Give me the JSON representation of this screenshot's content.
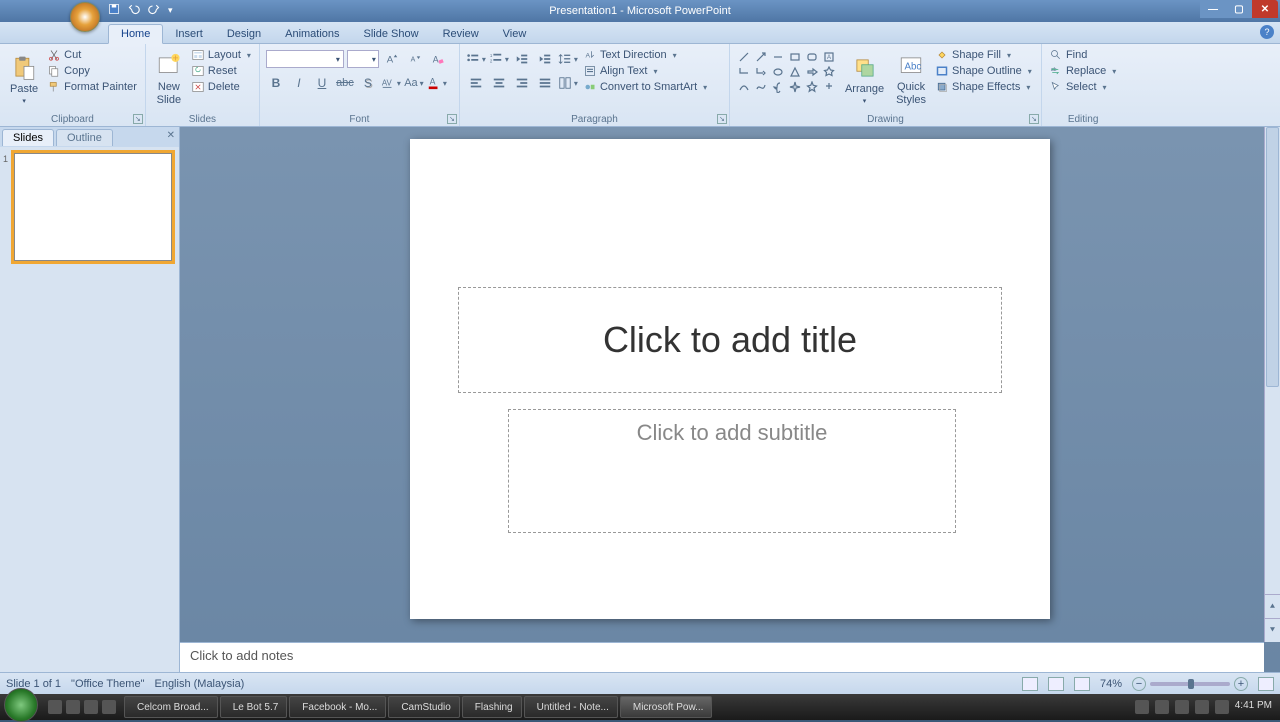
{
  "window": {
    "title": "Presentation1 - Microsoft PowerPoint"
  },
  "tabs": [
    "Home",
    "Insert",
    "Design",
    "Animations",
    "Slide Show",
    "Review",
    "View"
  ],
  "active_tab": "Home",
  "ribbon": {
    "clipboard": {
      "label": "Clipboard",
      "paste": "Paste",
      "cut": "Cut",
      "copy": "Copy",
      "format_painter": "Format Painter"
    },
    "slides": {
      "label": "Slides",
      "new_slide": "New\nSlide",
      "layout": "Layout",
      "reset": "Reset",
      "delete": "Delete"
    },
    "font": {
      "label": "Font",
      "name": "",
      "size": ""
    },
    "paragraph": {
      "label": "Paragraph",
      "text_direction": "Text Direction",
      "align_text": "Align Text",
      "convert": "Convert to SmartArt"
    },
    "drawing": {
      "label": "Drawing",
      "arrange": "Arrange",
      "quick_styles": "Quick\nStyles",
      "shape_fill": "Shape Fill",
      "shape_outline": "Shape Outline",
      "shape_effects": "Shape Effects"
    },
    "editing": {
      "label": "Editing",
      "find": "Find",
      "replace": "Replace",
      "select": "Select"
    }
  },
  "slidepane": {
    "tabs": [
      "Slides",
      "Outline"
    ],
    "active": "Slides",
    "thumbs": [
      {
        "num": "1"
      }
    ]
  },
  "editor": {
    "title_placeholder": "Click to add title",
    "subtitle_placeholder": "Click to add subtitle",
    "notes_placeholder": "Click to add notes"
  },
  "statusbar": {
    "slide": "Slide 1 of 1",
    "theme": "\"Office Theme\"",
    "lang": "English (Malaysia)",
    "zoom": "74%"
  },
  "taskbar": {
    "items": [
      "Celcom Broad...",
      "Le Bot 5.7",
      "Facebook - Mo...",
      "CamStudio",
      "Flashing",
      "Untitled - Note...",
      "Microsoft Pow..."
    ],
    "time": "4:41 PM"
  }
}
